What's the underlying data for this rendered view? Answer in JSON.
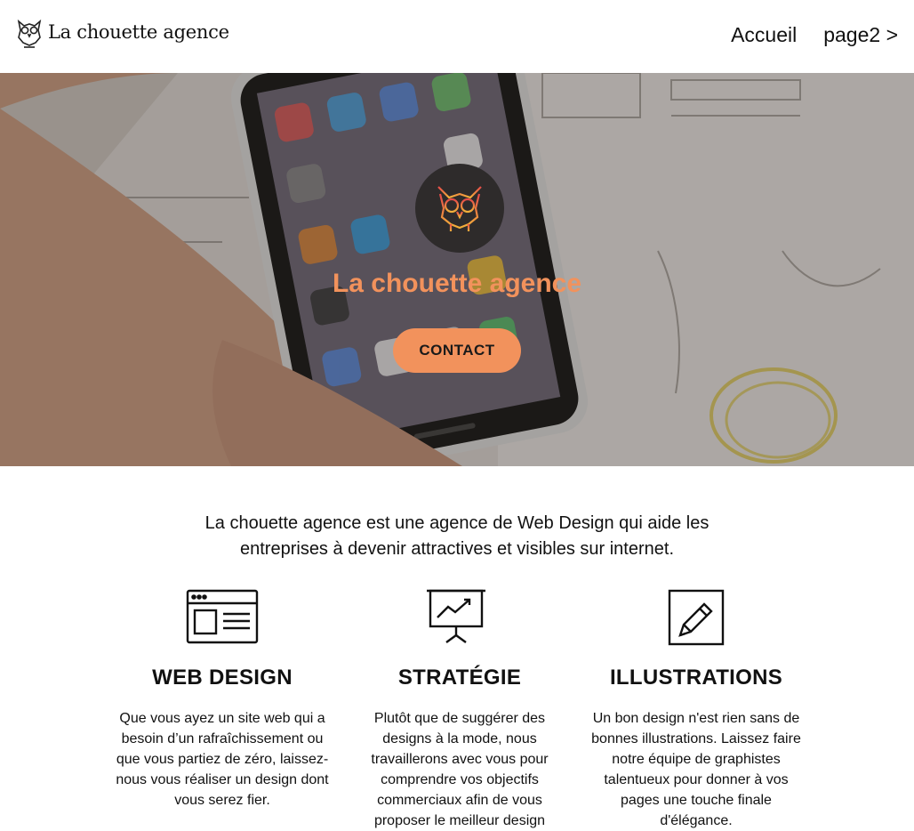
{
  "header": {
    "brand_name": "La chouette agence",
    "nav": [
      {
        "label": "Accueil"
      },
      {
        "label": "page2 >"
      }
    ]
  },
  "hero": {
    "title": "La chouette agence",
    "contact_label": "CONTACT",
    "colors": {
      "accent": "#f2925c",
      "logo_bg": "#2e2b2b"
    }
  },
  "intro": {
    "text": "La chouette agence est une agence de Web Design qui aide les entreprises à devenir attractives et visibles sur internet."
  },
  "services": [
    {
      "icon": "web-design-icon",
      "title": "WEB DESIGN",
      "text": "Que vous ayez un site web qui a besoin d’un rafraîchissement ou que vous partiez de zéro, laissez-nous vous réaliser un design dont vous serez fier."
    },
    {
      "icon": "strategy-chart-icon",
      "title": "STRATÉGIE",
      "text": "Plutôt que de suggérer des designs à la mode, nous travaillerons avec vous pour comprendre vos objectifs commerciaux afin de vous proposer le meilleur design"
    },
    {
      "icon": "pencil-icon",
      "title": "ILLUSTRATIONS",
      "text": "Un bon design n'est rien sans de bonnes illustrations. Laissez faire notre équipe de graphistes talentueux pour donner à vos pages une touche finale d'élégance."
    }
  ]
}
